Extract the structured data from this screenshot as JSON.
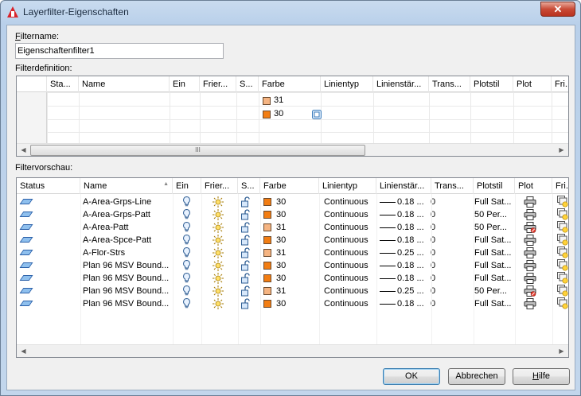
{
  "window": {
    "title": "Layerfilter-Eigenschaften",
    "close_glyph": "✕"
  },
  "filtername": {
    "label": "Filtername:",
    "value": "Eigenschaftenfilter1"
  },
  "filterdefinition": {
    "label": "Filterdefinition:",
    "columns": [
      "Sta...",
      "Name",
      "Ein",
      "Frier...",
      "S...",
      "Farbe",
      "Linientyp",
      "Linienstär...",
      "Trans...",
      "Plotstil",
      "Plot",
      "Fri..."
    ],
    "rows": [
      {
        "color": "31",
        "swatch": "#f5b482"
      },
      {
        "color": "30",
        "swatch": "#f27d12",
        "has_button": true
      }
    ],
    "thumb_label": "III"
  },
  "filtervorschau": {
    "label": "Filtervorschau:",
    "columns": [
      "Status",
      "Name",
      "Ein",
      "Frier...",
      "S...",
      "Farbe",
      "Linientyp",
      "Linienstär...",
      "Trans...",
      "Plotstil",
      "Plot",
      "Fri..."
    ],
    "sort_glyph": "▲",
    "rows": [
      {
        "name": "A-Area-Grps-Line",
        "color": "30",
        "linetype": "Continuous",
        "lineweight": "0.18 ...",
        "trans": "0",
        "plotstyle": "Full Sat...",
        "noplot": false
      },
      {
        "name": "A-Area-Grps-Patt",
        "color": "30",
        "linetype": "Continuous",
        "lineweight": "0.18 ...",
        "trans": "0",
        "plotstyle": "50 Per...",
        "noplot": false
      },
      {
        "name": "A-Area-Patt",
        "color": "31",
        "linetype": "Continuous",
        "lineweight": "0.18 ...",
        "trans": "0",
        "plotstyle": "50 Per...",
        "noplot": true
      },
      {
        "name": "A-Area-Spce-Patt",
        "color": "30",
        "linetype": "Continuous",
        "lineweight": "0.18 ...",
        "trans": "0",
        "plotstyle": "Full Sat...",
        "noplot": false
      },
      {
        "name": "A-Flor-Strs",
        "color": "31",
        "linetype": "Continuous",
        "lineweight": "0.25 ...",
        "trans": "0",
        "plotstyle": "Full Sat...",
        "noplot": false
      },
      {
        "name": "Plan 96 MSV Bound...",
        "color": "30",
        "linetype": "Continuous",
        "lineweight": "0.18 ...",
        "trans": "0",
        "plotstyle": "Full Sat...",
        "noplot": false
      },
      {
        "name": "Plan 96 MSV Bound...",
        "color": "30",
        "linetype": "Continuous",
        "lineweight": "0.18 ...",
        "trans": "0",
        "plotstyle": "Full Sat...",
        "noplot": false
      },
      {
        "name": "Plan 96 MSV Bound...",
        "color": "31",
        "linetype": "Continuous",
        "lineweight": "0.25 ...",
        "trans": "0",
        "plotstyle": "50 Per...",
        "noplot": true
      },
      {
        "name": "Plan 96 MSV Bound...",
        "color": "30",
        "linetype": "Continuous",
        "lineweight": "0.18 ...",
        "trans": "0",
        "plotstyle": "Full Sat...",
        "noplot": false
      }
    ]
  },
  "colors": {
    "30": "#f27d12",
    "31": "#f5b482",
    "accent": "#3c7fb1"
  },
  "buttons": {
    "ok": "OK",
    "cancel": "Abbrechen",
    "help": "Hilfe"
  }
}
